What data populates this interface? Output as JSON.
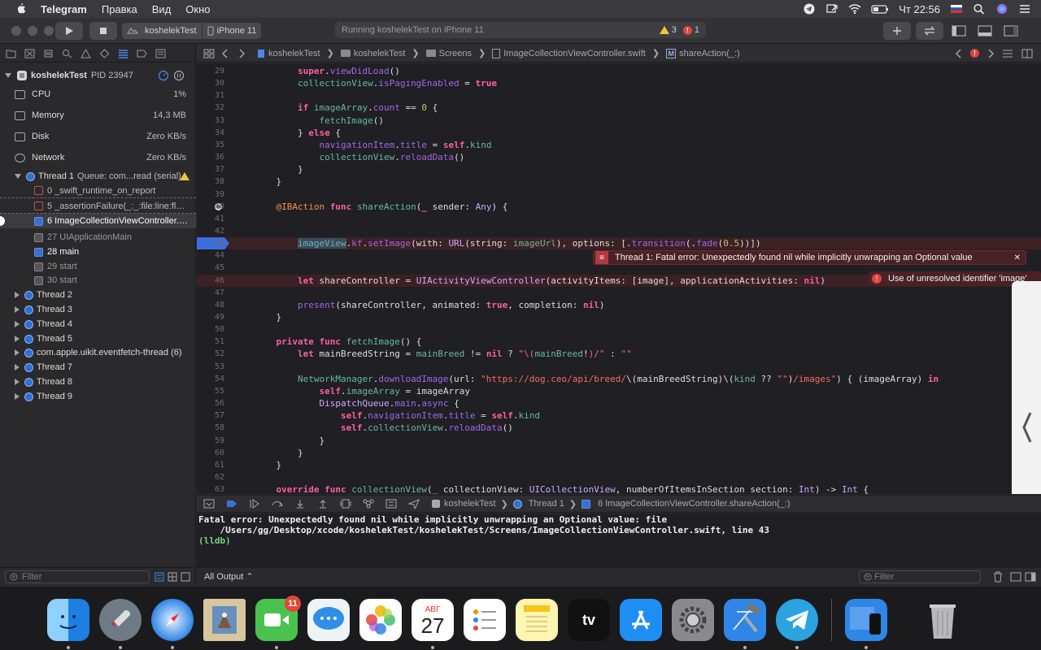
{
  "menubar": {
    "app_name": "Telegram",
    "items": [
      "Правка",
      "Вид",
      "Окно"
    ],
    "clock": "Чт 22:56"
  },
  "toolbar": {
    "scheme_project": "koshelekTest",
    "scheme_device": "iPhone 11",
    "activity_text": "Running koshelekTest on iPhone 11",
    "warning_count": "3",
    "error_count": "1"
  },
  "navigator": {
    "process_name": "koshelekTest",
    "process_pid": "PID 23947",
    "gauges": [
      {
        "name": "CPU",
        "value": "1%"
      },
      {
        "name": "Memory",
        "value": "14,3 MB"
      },
      {
        "name": "Disk",
        "value": "Zero KB/s"
      },
      {
        "name": "Network",
        "value": "Zero KB/s"
      }
    ],
    "thread1_label": "Thread 1",
    "thread1_queue": "Queue: com...read (serial)",
    "frames": [
      {
        "label": "0 _swift_runtime_on_report",
        "kind": "err"
      },
      {
        "label": "5 _assertionFailure(_:_:file:line:flags:)",
        "kind": "err"
      },
      {
        "label": "6 ImageCollectionViewController.s...",
        "kind": "user"
      },
      {
        "label": "27 UIApplicationMain",
        "kind": "sys"
      },
      {
        "label": "28 main",
        "kind": "user"
      },
      {
        "label": "29 start",
        "kind": "sys"
      },
      {
        "label": "30 start",
        "kind": "sys"
      }
    ],
    "threads": [
      "Thread 2",
      "Thread 3",
      "Thread 4",
      "Thread 5",
      "com.apple.uikit.eventfetch-thread (6)",
      "Thread 7",
      "Thread 8",
      "Thread 9"
    ],
    "filter_placeholder": "Filter"
  },
  "jumpbar": {
    "crumbs": [
      "koshelekTest",
      "koshelekTest",
      "Screens",
      "ImageCollectionViewController.swift",
      "shareAction(_:)"
    ]
  },
  "editor": {
    "lines": [
      {
        "n": "29",
        "html": "        <span class='kw'>super</span>.<span class='pr'>viewDidLoad</span>()"
      },
      {
        "n": "30",
        "html": "        <span class='fn'>collectionView</span>.<span class='pr'>isPagingEnabled</span> = <span class='kw'>true</span>"
      },
      {
        "n": "31",
        "html": ""
      },
      {
        "n": "32",
        "html": "        <span class='kw'>if</span> <span class='fn'>imageArray</span>.<span class='pr'>count</span> == <span class='nm'>0</span> {"
      },
      {
        "n": "33",
        "html": "            <span class='fn'>fetchImage</span>()"
      },
      {
        "n": "34",
        "html": "        } <span class='kw'>else</span> {"
      },
      {
        "n": "35",
        "html": "            <span class='pr'>navigationItem</span>.<span class='pr'>title</span> = <span class='kw'>self</span>.<span class='fn'>kind</span>"
      },
      {
        "n": "36",
        "html": "            <span class='fn'>collectionView</span>.<span class='pr'>reloadData</span>()"
      },
      {
        "n": "37",
        "html": "        }"
      },
      {
        "n": "38",
        "html": "    }"
      },
      {
        "n": "39",
        "html": ""
      },
      {
        "n": "40",
        "html": "    <span class='at'>@IBAction</span> <span class='kw'>func</span> <span class='fn'>shareAction</span>(<span class='kw'>_</span> sender: <span class='ty'>Any</span>) {"
      },
      {
        "n": "41",
        "html": ""
      },
      {
        "n": "42",
        "html": ""
      },
      {
        "n": "43",
        "html": "        <span class='fn hl'>imageView</span>.<span class='pr'>kf</span>.<span class='pr'>setImage</span>(with: <span class='ty'>URL</span>(string: <span class='fn'>imageUrl</span>), options: [.<span class='pr'>transition</span>(.<span class='pr'>fade</span>(<span class='nm'>0.5</span>))])"
      },
      {
        "n": "44",
        "html": ""
      },
      {
        "n": "45",
        "html": ""
      },
      {
        "n": "46",
        "html": "        <span class='kw'>let</span> shareController = <span class='ty'>UIActivityViewController</span>(activityItems: [image], applicationActivities: <span class='kw'>nil</span>)"
      },
      {
        "n": "47",
        "html": ""
      },
      {
        "n": "48",
        "html": "        <span class='pr'>present</span>(shareController, animated: <span class='kw'>true</span>, completion: <span class='kw'>nil</span>)"
      },
      {
        "n": "49",
        "html": "    }"
      },
      {
        "n": "50",
        "html": ""
      },
      {
        "n": "51",
        "html": "    <span class='kw'>private</span> <span class='kw'>func</span> <span class='fn'>fetchImage</span>() {"
      },
      {
        "n": "52",
        "html": "        <span class='kw'>let</span> mainBreedString = <span class='fn'>mainBreed</span> != <span class='kw'>nil</span> ? <span class='st'>\"\\(</span><span class='fn'>mainBreed</span>!<span class='st'>)/\"</span> : <span class='st'>\"\"</span>"
      },
      {
        "n": "53",
        "html": ""
      },
      {
        "n": "54",
        "html": "        <span class='fn'>NetworkManager</span>.<span class='pr'>downloadImage</span>(url: <span class='st'>\"https://dog.ceo/api/breed/</span>\\(mainBreedString)\\(<span class='fn'>kind</span> ?? <span class='st'>\"\"</span>)<span class='st'>/images\"</span>) { (imageArray) <span class='kw'>in</span>"
      },
      {
        "n": "55",
        "html": "            <span class='kw'>self</span>.<span class='fn'>imageArray</span> = imageArray"
      },
      {
        "n": "56",
        "html": "            <span class='ty'>DispatchQueue</span>.<span class='pr'>main</span>.<span class='pr'>async</span> {"
      },
      {
        "n": "57",
        "html": "                <span class='kw'>self</span>.<span class='pr'>navigationItem</span>.<span class='pr'>title</span> = <span class='kw'>self</span>.<span class='fn'>kind</span>"
      },
      {
        "n": "58",
        "html": "                <span class='kw'>self</span>.<span class='fn'>collectionView</span>.<span class='pr'>reloadData</span>()"
      },
      {
        "n": "59",
        "html": "            }"
      },
      {
        "n": "60",
        "html": "        }"
      },
      {
        "n": "61",
        "html": "    }"
      },
      {
        "n": "62",
        "html": ""
      },
      {
        "n": "63",
        "html": "    <span class='kw'>override</span> <span class='kw'>func</span> <span class='fn'>collectionView</span>(<span class='kw'>_</span> collectionView: <span class='ty'>UICollectionView</span>, numberOfItemsInSection section: <span class='ty'>Int</span>) -> <span class='ty'>Int</span> {"
      }
    ],
    "fatal_banner": "Thread 1: Fatal error: Unexpectedly found nil while implicitly unwrapping an Optional value",
    "issue_banner": "Use of unresolved identifier 'image'"
  },
  "debugbar": {
    "crumbs": [
      "koshelekTest",
      "Thread 1",
      "6 ImageCollectionViewController.shareAction(_:)"
    ]
  },
  "console": {
    "line1": "Fatal error: Unexpectedly found nil while implicitly unwrapping an Optional value: file",
    "line2": "    /Users/gg/Desktop/xcode/koshelekTest/koshelekTest/Screens/ImageCollectionViewController.swift, line 43",
    "line3": "(lldb)"
  },
  "bottombar": {
    "output_selector": "All Output",
    "filter_placeholder": "Filter"
  },
  "dock": {
    "messages_badge": "11",
    "calendar_month": "АВГ",
    "calendar_day": "27",
    "tv_label": "tv"
  },
  "colors": {
    "accent": "#3d6edb",
    "error": "#e0443e",
    "warning": "#f2c53d"
  }
}
